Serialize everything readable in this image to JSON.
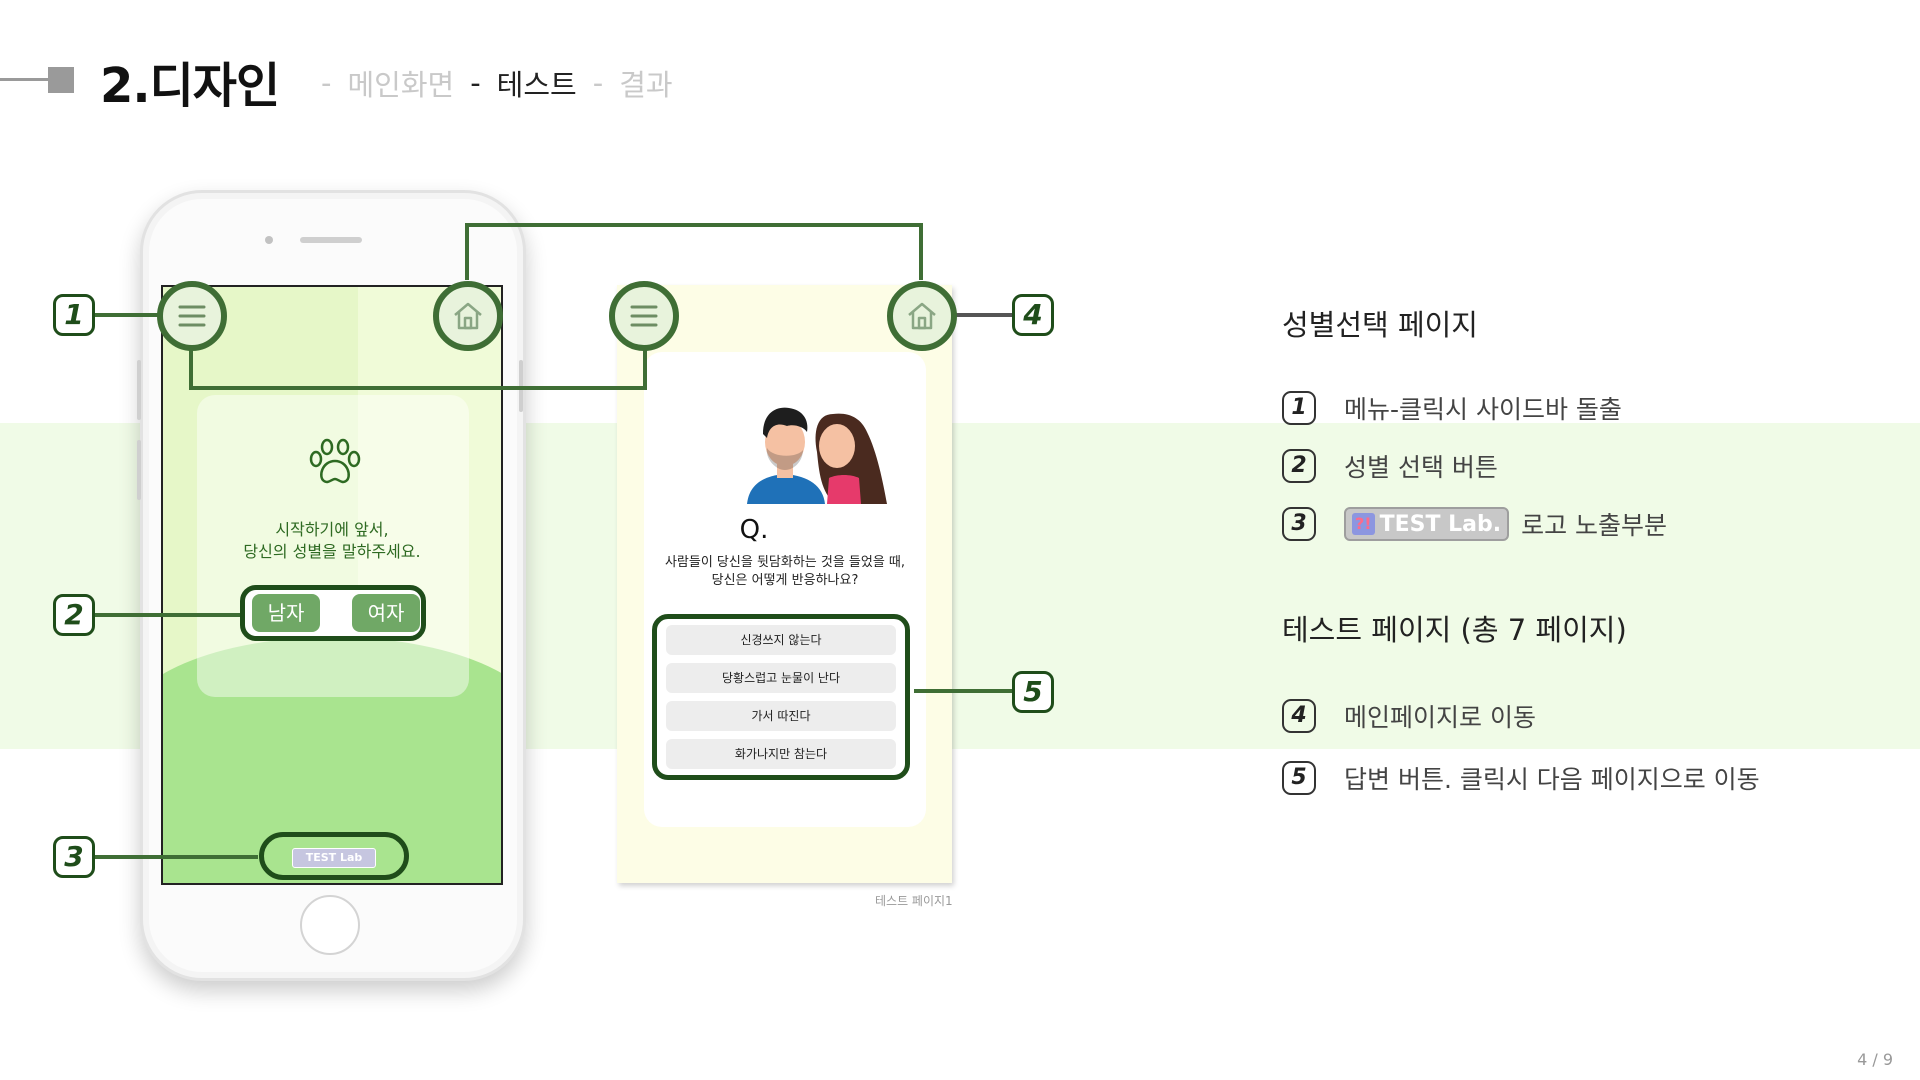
{
  "header": {
    "title": "2.디자인",
    "nav": {
      "dash1": "-",
      "item1": "메인화면",
      "dash2": "-",
      "item2": "테스트",
      "dash3": "-",
      "item3": "결과"
    }
  },
  "phone": {
    "message_line1": "시작하기에 앞서,",
    "message_line2": "당신의 성별을 말하주세요.",
    "male_button": "남자",
    "female_button": "여자",
    "logo_mini": "TEST Lab"
  },
  "test_page": {
    "question_mark": "Q.",
    "question_line1": "사람들이 당신을 뒷담화하는 것을 들었을 때,",
    "question_line2": "당신은 어떻게 반응하나요?",
    "answers": [
      "신경쓰지 않는다",
      "당황스럽고 눈물이 난다",
      "가서 따진다",
      "화가나지만 참는다"
    ],
    "caption": "테스트 페이지1"
  },
  "callouts": [
    "1",
    "2",
    "3",
    "4",
    "5"
  ],
  "panel": {
    "section1_title": "성별선택 페이지",
    "section1_items": [
      {
        "num": "1",
        "text": "메뉴-클릭시 사이드바 돌출"
      },
      {
        "num": "2",
        "text": "성별 선택 버튼"
      },
      {
        "num": "3",
        "text": "로고 노출부분",
        "logo_q": "?!",
        "logo_text": "TEST Lab."
      }
    ],
    "section2_title": "테스트 페이지 (총 7 페이지)",
    "section2_items": [
      {
        "num": "4",
        "text": "메인페이지로 이동"
      },
      {
        "num": "5",
        "text": "답변 버튼. 클릭시 다음 페이지으로 이동"
      }
    ]
  },
  "page_number": "4 / 9",
  "colors": {
    "accent_dark_green": "#1f4d1a",
    "icon_green": "#3f6e35",
    "band": "#f0fbe7",
    "button_green": "#70a866"
  },
  "icons": [
    "menu-icon",
    "home-icon",
    "paw-icon"
  ]
}
